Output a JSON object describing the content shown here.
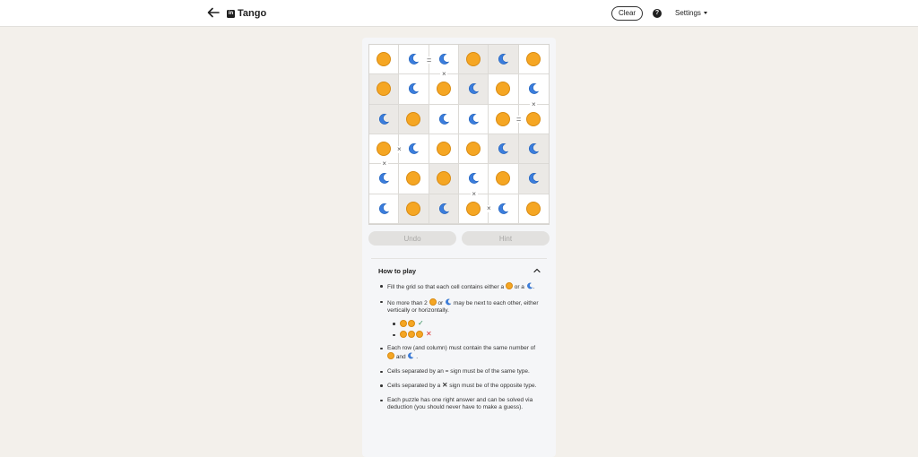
{
  "header": {
    "title": "Tango",
    "brand_mark": "in",
    "clear_label": "Clear",
    "help_label": "?",
    "settings_label": "Settings"
  },
  "grid": {
    "rows": [
      [
        "sun",
        "moon",
        "moon",
        "sun",
        "moon",
        "sun"
      ],
      [
        "sun",
        "moon",
        "sun",
        "moon",
        "sun",
        "moon"
      ],
      [
        "moon",
        "sun",
        "moon",
        "moon",
        "sun",
        "sun"
      ],
      [
        "sun",
        "moon",
        "sun",
        "sun",
        "moon",
        "moon"
      ],
      [
        "moon",
        "sun",
        "sun",
        "moon",
        "sun",
        "moon"
      ],
      [
        "moon",
        "sun",
        "moon",
        "sun",
        "moon",
        "sun"
      ]
    ],
    "locked": [
      [
        false,
        false,
        false,
        true,
        true,
        false
      ],
      [
        true,
        false,
        false,
        true,
        false,
        false
      ],
      [
        true,
        true,
        false,
        false,
        false,
        false
      ],
      [
        false,
        false,
        false,
        false,
        true,
        true
      ],
      [
        false,
        false,
        true,
        false,
        false,
        true
      ],
      [
        false,
        true,
        true,
        false,
        false,
        false
      ]
    ],
    "signs": [
      {
        "type": "eq",
        "between": "r0c1-r0c2",
        "glyph": "="
      },
      {
        "type": "x",
        "between": "r0c2-r1c2",
        "glyph": "×"
      },
      {
        "type": "x",
        "between": "r1c5-r2c5",
        "glyph": "×"
      },
      {
        "type": "eq",
        "between": "r2c4-r2c5",
        "glyph": "="
      },
      {
        "type": "x",
        "between": "r3c0-r3c1",
        "glyph": "×"
      },
      {
        "type": "x",
        "between": "r3c0-r4c0",
        "glyph": "×"
      },
      {
        "type": "x",
        "between": "r4c3-r5c3",
        "glyph": "×"
      },
      {
        "type": "x",
        "between": "r5c3-r5c4",
        "glyph": "×"
      }
    ]
  },
  "controls": {
    "undo_label": "Undo",
    "hint_label": "Hint"
  },
  "how_to_play": {
    "title": "How to play",
    "rule1_a": "Fill the grid so that each cell contains either a",
    "rule1_b": "or",
    "rule1_c": "a",
    "rule1_d": ".",
    "rule2_a": "No more than 2",
    "rule2_b": "or",
    "rule2_c": "may be next to each other, either vertically or horizontally.",
    "ok_mark": "✓",
    "bad_mark": "✕",
    "rule3_a": "Each row (and column) must contain the same number of",
    "rule3_b": "and",
    "rule3_c": ".",
    "rule4": "Cells separated by an = sign must be of the same type.",
    "rule5_a": "Cells separated by a",
    "rule5_x": "✕",
    "rule5_b": "sign must be of the opposite type.",
    "rule6": "Each puzzle has one right answer and can be solved via deduction (you should never have to make a guess)."
  },
  "colors": {
    "sun": "#f5a623",
    "moon": "#3b7ddd",
    "locked_cell": "#ebe9e6",
    "page_bg": "#f3f0eb"
  }
}
